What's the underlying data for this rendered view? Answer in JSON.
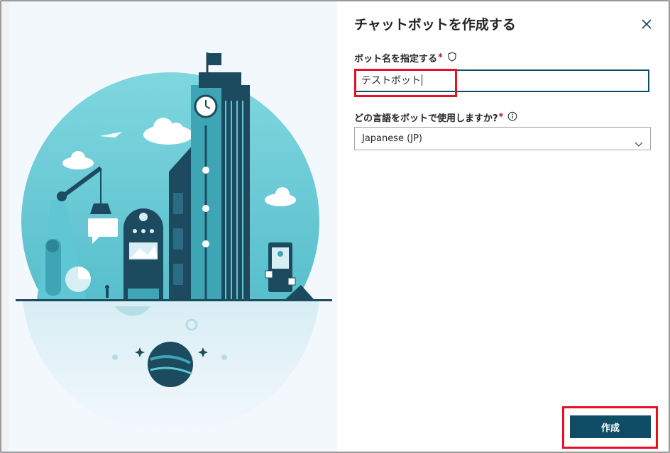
{
  "dialog": {
    "title": "チャットボットを作成する",
    "close_icon": "close-icon"
  },
  "bot_name": {
    "label": "ボット名を指定する",
    "required_mark": "*",
    "value": "テストボット",
    "help_icon": "shield-icon"
  },
  "language": {
    "label": "どの言語をボットで使用しますか?",
    "required_mark": "*",
    "selected": "Japanese (JP)",
    "info_icon": "info-icon"
  },
  "actions": {
    "create_label": "作成"
  },
  "colors": {
    "primary": "#0f4c66",
    "highlight": "#e81123",
    "illustration_bg": "#f3f8fd",
    "teal": "#5ec7d3"
  }
}
